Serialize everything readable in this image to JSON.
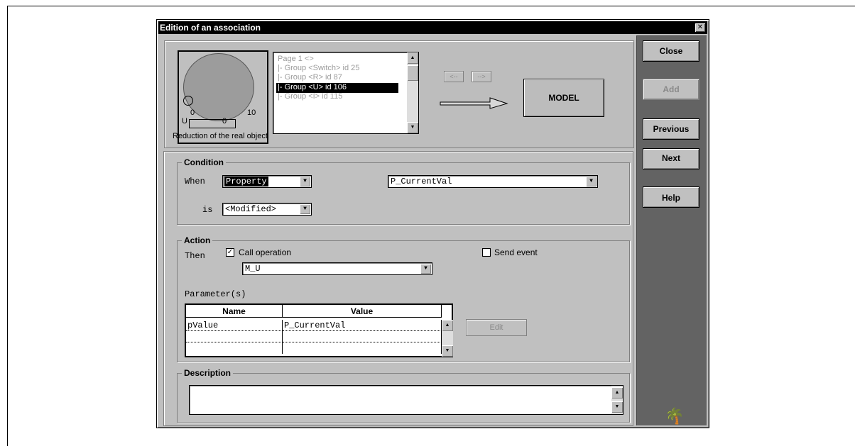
{
  "window": {
    "title": "Edition of an association",
    "close_symbol": "✕"
  },
  "side_buttons": [
    {
      "label": "Close",
      "enabled": true
    },
    {
      "label": "Add",
      "enabled": false
    },
    {
      "label": "Previous",
      "enabled": true
    },
    {
      "label": "Next",
      "enabled": true
    },
    {
      "label": "Help",
      "enabled": true
    }
  ],
  "preview": {
    "caption": "Reduction of the real object",
    "labels": {
      "left": "0",
      "right": "10",
      "u": "U",
      "zero": "0"
    }
  },
  "tree": {
    "items": [
      {
        "label": "Page 1 <>",
        "selected": false
      },
      {
        "label": "|- Group <Switch> id 25",
        "selected": false
      },
      {
        "label": "|- Group <R> id 87",
        "selected": false
      },
      {
        "label": "|- Group <U> id 106",
        "selected": true
      },
      {
        "label": "|- Group <I> id 115",
        "selected": false
      }
    ]
  },
  "nav": {
    "prev": "<--",
    "next": "-->"
  },
  "model_label": "MODEL",
  "condition": {
    "title": "Condition",
    "when_label": "When",
    "when_value": "Property",
    "property_value": "P_CurrentVal",
    "is_label": "is",
    "is_value": "<Modified>"
  },
  "action": {
    "title": "Action",
    "then_label": "Then",
    "call_operation_label": "Call operation",
    "call_operation_checked": true,
    "send_event_label": "Send event",
    "send_event_checked": false,
    "operation_value": "M_U",
    "parameters_label": "Parameter(s)",
    "columns": [
      "Name",
      "Value"
    ],
    "rows": [
      {
        "name": "pValue",
        "value": "P_CurrentVal"
      }
    ],
    "edit_label": "Edit"
  },
  "description": {
    "title": "Description",
    "text": ""
  },
  "colors": {
    "title_bar": "#000000",
    "dialog_bg": "#c0c0c0",
    "side_panel": "#636363"
  }
}
